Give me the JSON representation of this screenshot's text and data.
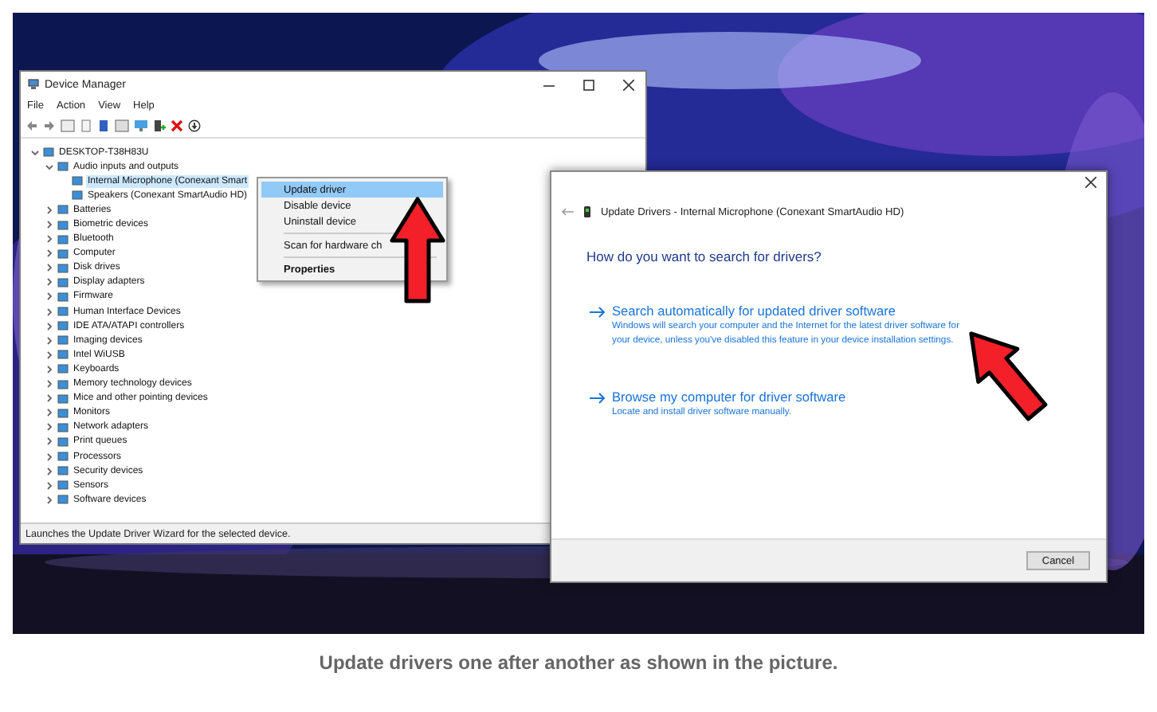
{
  "device_manager": {
    "title": "Device Manager",
    "menu": [
      "File",
      "Action",
      "View",
      "Help"
    ],
    "tree": [
      {
        "label": "DESKTOP-T38H83U",
        "expanded": true,
        "selected": false,
        "children": [
          {
            "label": "Audio inputs and outputs",
            "expanded": true,
            "selected": false,
            "children": [
              {
                "label": "Internal Microphone (Conexant Smart",
                "selected": true
              },
              {
                "label": "Speakers (Conexant SmartAudio HD)",
                "selected": false
              }
            ]
          },
          {
            "label": "Batteries",
            "expanded": false,
            "selected": false
          },
          {
            "label": "Biometric devices",
            "expanded": false,
            "selected": false
          },
          {
            "label": "Bluetooth",
            "expanded": false,
            "selected": false
          },
          {
            "label": "Computer",
            "expanded": false,
            "selected": false
          },
          {
            "label": "Disk drives",
            "expanded": false,
            "selected": false
          },
          {
            "label": "Display adapters",
            "expanded": false,
            "selected": false
          },
          {
            "label": "Firmware",
            "expanded": false,
            "selected": false
          },
          {
            "label": "Human Interface Devices",
            "expanded": false,
            "selected": false
          },
          {
            "label": "IDE ATA/ATAPI controllers",
            "expanded": false,
            "selected": false
          },
          {
            "label": "Imaging devices",
            "expanded": false,
            "selected": false
          },
          {
            "label": "Intel WiUSB",
            "expanded": false,
            "selected": false
          },
          {
            "label": "Keyboards",
            "expanded": false,
            "selected": false
          },
          {
            "label": "Memory technology devices",
            "expanded": false,
            "selected": false
          },
          {
            "label": "Mice and other pointing devices",
            "expanded": false,
            "selected": false
          },
          {
            "label": "Monitors",
            "expanded": false,
            "selected": false
          },
          {
            "label": "Network adapters",
            "expanded": false,
            "selected": false
          },
          {
            "label": "Print queues",
            "expanded": false,
            "selected": false
          },
          {
            "label": "Processors",
            "expanded": false,
            "selected": false
          },
          {
            "label": "Security devices",
            "expanded": false,
            "selected": false
          },
          {
            "label": "Sensors",
            "expanded": false,
            "selected": false
          },
          {
            "label": "Software devices",
            "expanded": false,
            "selected": false
          }
        ]
      }
    ],
    "status_bar": "Launches the Update Driver Wizard for the selected device."
  },
  "context_menu": [
    {
      "kind": "item",
      "label": "Update driver",
      "selected": true
    },
    {
      "kind": "item",
      "label": "Disable device",
      "selected": false
    },
    {
      "kind": "item",
      "label": "Uninstall device",
      "selected": false
    },
    {
      "kind": "separator"
    },
    {
      "kind": "item",
      "label": "Scan for hardware ch",
      "selected": false
    },
    {
      "kind": "separator"
    },
    {
      "kind": "default",
      "label": "Properties",
      "selected": false
    }
  ],
  "dialog": {
    "title": "Update Drivers - Internal Microphone (Conexant SmartAudio HD)",
    "heading": "How do you want to search for drivers?",
    "options": [
      {
        "title": "Search automatically for updated driver software",
        "description": "Windows will search your computer and the Internet for the latest driver software for your device, unless you've disabled this feature in your device installation settings."
      },
      {
        "title": "Browse my computer for driver software",
        "description": "Locate and install driver software manually."
      }
    ],
    "buttons": [
      "Cancel"
    ]
  },
  "caption": "Update drivers one after another as shown in the picture."
}
